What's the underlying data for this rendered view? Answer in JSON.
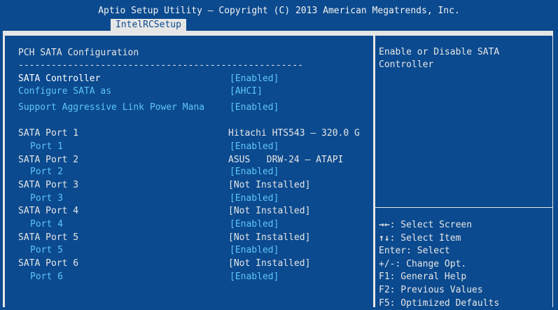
{
  "header": {
    "title": "Aptio Setup Utility – Copyright (C) 2013 American Megatrends, Inc.",
    "tab": "IntelRCSetup"
  },
  "left": {
    "section_title": "PCH SATA Configuration",
    "separator": "----------------------------------------------------",
    "rows": [
      {
        "label": "SATA Controller",
        "value": "[Enabled]"
      },
      {
        "label": "Configure SATA as",
        "value": "[AHCI]"
      },
      {
        "label": "Support Aggressive Link Power Mana",
        "value": "[Enabled]"
      },
      {
        "label": "SATA Port 1",
        "value": "Hitachi HTS543 – 320.0 G"
      },
      {
        "label": "Port 1",
        "value": "[Enabled]"
      },
      {
        "label": "SATA Port 2",
        "value": "ASUS   DRW-24 – ATAPI"
      },
      {
        "label": "Port 2",
        "value": "[Enabled]"
      },
      {
        "label": "SATA Port 3",
        "value": "[Not Installed]"
      },
      {
        "label": "Port 3",
        "value": "[Enabled]"
      },
      {
        "label": "SATA Port 4",
        "value": "[Not Installed]"
      },
      {
        "label": "Port 4",
        "value": "[Enabled]"
      },
      {
        "label": "SATA Port 5",
        "value": "[Not Installed]"
      },
      {
        "label": "Port 5",
        "value": "[Enabled]"
      },
      {
        "label": "SATA Port 6",
        "value": "[Not Installed]"
      },
      {
        "label": "Port 6",
        "value": "[Enabled]"
      }
    ]
  },
  "help": {
    "line1": "Enable or Disable SATA",
    "line2": "Controller"
  },
  "keys": [
    {
      "key": "→←",
      "desc": ": Select Screen"
    },
    {
      "key": "↑↓",
      "desc": ": Select Item"
    },
    {
      "key": "",
      "desc": "Enter: Select"
    },
    {
      "key": "",
      "desc": "+/-: Change Opt."
    },
    {
      "key": "",
      "desc": "F1: General Help"
    },
    {
      "key": "",
      "desc": "F2: Previous Values"
    },
    {
      "key": "",
      "desc": "F5: Optimized Defaults"
    }
  ],
  "colors": {
    "background": "#0b4a8f",
    "text": "#e6e6e6",
    "selectable": "#5fc6f5",
    "tab_bg": "#e6e6e6"
  }
}
